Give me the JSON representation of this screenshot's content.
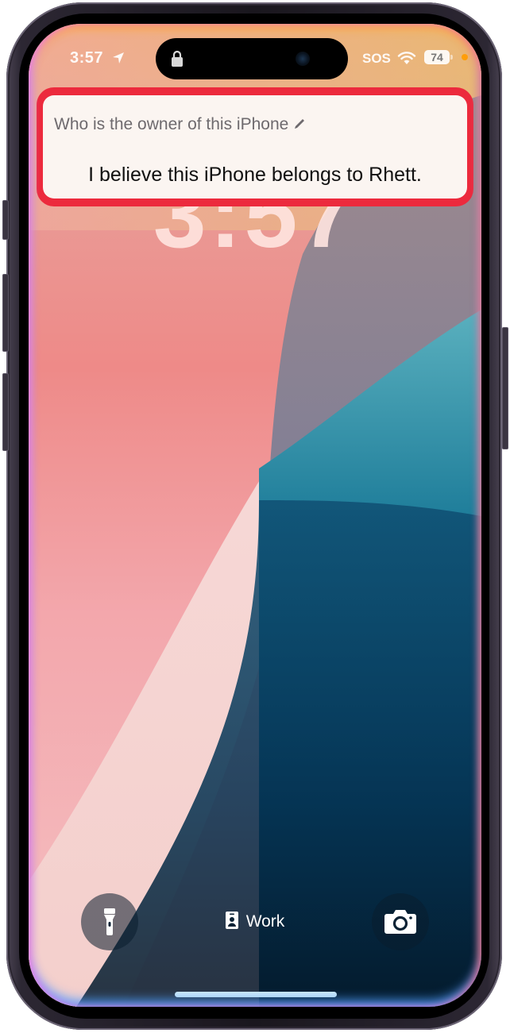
{
  "status_bar": {
    "time": "3:57",
    "location_icon": "location-arrow-icon",
    "island_icon": "lock-icon",
    "carrier": "SOS",
    "wifi_icon": "wifi-icon",
    "battery_percent": "74",
    "privacy_indicator_color": "#ff9f0a"
  },
  "lock_screen": {
    "clock": "3:57"
  },
  "siri_card": {
    "query": "Who is the owner of this iPhone",
    "edit_icon": "pencil-icon",
    "answer": "I believe this iPhone belongs to Rhett.",
    "highlight_color": "#ec2a3d"
  },
  "bottom_bar": {
    "flashlight_icon": "flashlight-icon",
    "focus_icon": "id-badge-icon",
    "focus_label": "Work",
    "camera_icon": "camera-icon"
  }
}
